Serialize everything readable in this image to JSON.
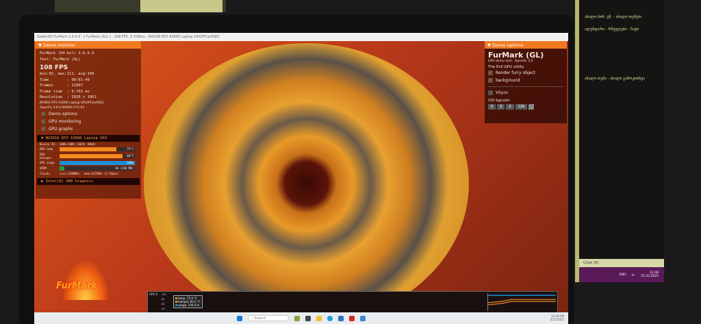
{
  "window": {
    "title": "Geeks3D FurMark 2.6.0.0 - [ FurMark (GL) ] - 108 FPS, 9.708ms - NVIDIA RTX A3000 Laptop GPU/PCIe/SSE2"
  },
  "demo_monitor": {
    "header": "Demo monitor",
    "app": "FurMark (64-bit) 2.6.0.0",
    "test": "Test: FurMark (GL)",
    "fps": "108 FPS",
    "minmax": "min:92, max:111, avg:109",
    "stats": [
      "Time        : 00:01:49",
      "Frames      : 11097",
      "Frame time  : 9.743 ms",
      "Resolution  : 1920 x 1061"
    ],
    "gpu_info": [
      "NVIDIA RTX A3000 Laptop GPU/PCIe/SSE2",
      "OpenGL 4.6.0 NVIDIA 572.83"
    ],
    "checks": [
      {
        "label": "Demo options",
        "checked": true
      },
      {
        "label": "GPU monitoring",
        "checked": true
      },
      {
        "label": "GPU graphs",
        "checked": true
      }
    ]
  },
  "gpu": {
    "header": "NVIDIA RTX A3000 Laptop GPU",
    "device_id_label": "Device ID:",
    "device_id": "10DE-24B8 (1028- 0A6A)",
    "rows": [
      {
        "label": "GPU temp",
        "value": "75°C",
        "percent": 75,
        "color": "#f58a1f"
      },
      {
        "label": "GPU hotspot",
        "value": "84°C",
        "percent": 84,
        "color": "#f58a1f"
      },
      {
        "label": "GPU usage",
        "value": "100%",
        "percent": 100,
        "color": "#1f8ed8"
      },
      {
        "label": "VRAM",
        "value": "6% (246 MB)",
        "percent": 6,
        "color": "#22a040"
      }
    ],
    "clocks_label": "Clocks:",
    "clocks": "core:1290MHz - mem:1375MHz (5.5Gbps)",
    "intel": "Intel(R) UHD Graphics"
  },
  "demo_options": {
    "header": "Demo options",
    "title": "FurMark (GL)",
    "subtitle": "GPU stress test - OpenGL 3.2",
    "tagline": "The Evil GPU utility",
    "checks": [
      {
        "label": "Render furry object",
        "checked": true
      },
      {
        "label": "background",
        "checked": true
      },
      {
        "label": "VSync",
        "checked": false
      }
    ],
    "bgcolor_label": "OSI bgcolor",
    "bgcolor": [
      "0",
      "0",
      "0",
      "128"
    ]
  },
  "graph": {
    "label": "GPU 0",
    "yticks": [
      "100",
      "80",
      "60",
      "40"
    ],
    "legend": [
      {
        "label": "temp: 75.0 °C",
        "color": "#f58a1f"
      },
      {
        "label": "hotspot: 83.5 °C",
        "color": "#f58a1f"
      },
      {
        "label": "usage: 100.0 %",
        "color": "#1f8ed8"
      }
    ]
  },
  "logo": "FurMark",
  "taskbar": {
    "search": "Search",
    "time": "12:48 PM",
    "date": "3/21/2025"
  },
  "second_monitor": {
    "lines": [
      "ახალი პირ. გზ. - ახალი თემები",
      "ალენდარი - რჩეულები - ჩატი",
      "ახალი თემა - ახალი გამოკითხვა"
    ],
    "chat": "Chat (0)",
    "lang": "ENG",
    "time": "12:48",
    "date": "21.03.2025"
  }
}
